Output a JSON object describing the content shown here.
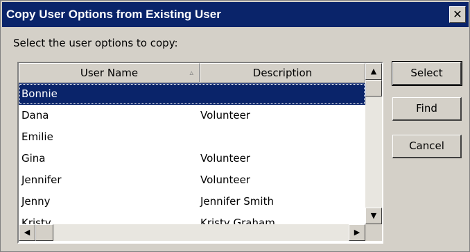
{
  "window": {
    "title": "Copy User Options from Existing User",
    "close_glyph": "✕"
  },
  "prompt": "Select the user options to copy:",
  "list": {
    "columns": [
      {
        "label": "User Name",
        "sort_icon": "▵"
      },
      {
        "label": "Description"
      }
    ],
    "rows": [
      {
        "name": "Bonnie",
        "description": "",
        "selected": true
      },
      {
        "name": "Dana",
        "description": "Volunteer"
      },
      {
        "name": "Emilie",
        "description": ""
      },
      {
        "name": "Gina",
        "description": "Volunteer"
      },
      {
        "name": "Jennifer",
        "description": "Volunteer"
      },
      {
        "name": "Jenny",
        "description": "Jennifer Smith"
      },
      {
        "name": "Kristy",
        "description": "Kristy Graham"
      }
    ],
    "scroll_glyphs": {
      "up": "▲",
      "down": "▼",
      "left": "◀",
      "right": "▶"
    }
  },
  "buttons": {
    "select": "Select",
    "find": "Find",
    "cancel": "Cancel"
  },
  "colors": {
    "titlebar": "#0a246a",
    "selection": "#0a246a",
    "face": "#d4d0c8"
  }
}
